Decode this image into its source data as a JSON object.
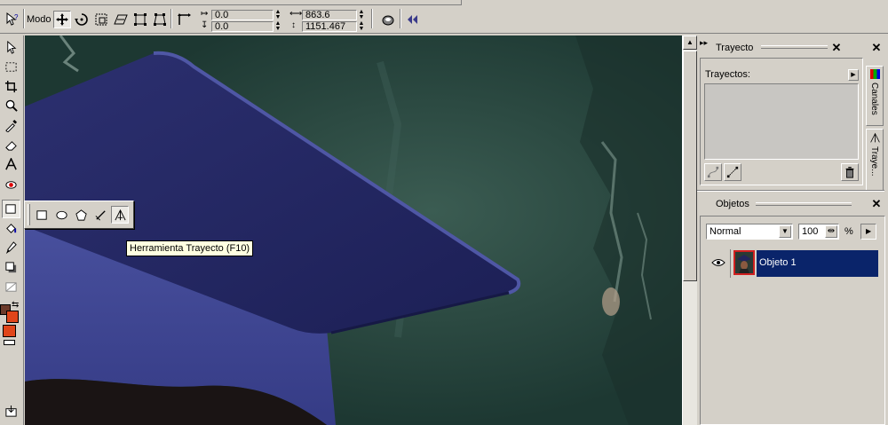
{
  "property_bar": {
    "mode_label": "Modo",
    "pos_x": "0.0",
    "pos_y": "0.0",
    "width": "863.6",
    "height": "1151.467"
  },
  "tools": [
    {
      "icon": "pick-tool-icon"
    },
    {
      "icon": "mask-tool-icon"
    },
    {
      "icon": "crop-tool-icon"
    },
    {
      "icon": "zoom-tool-icon"
    },
    {
      "icon": "eyedropper-tool-icon"
    },
    {
      "icon": "eraser-tool-icon"
    },
    {
      "icon": "text-tool-icon"
    },
    {
      "icon": "red-eye-tool-icon"
    },
    {
      "icon": "shape-tool-icon"
    },
    {
      "icon": "fill-tool-icon"
    },
    {
      "icon": "brush-tool-icon"
    },
    {
      "icon": "shadow-tool-icon"
    },
    {
      "icon": "transparency-tool-icon"
    }
  ],
  "colors": {
    "foreground": "#6b3a2a",
    "background": "#e0451a",
    "fill": "#e0451a",
    "selection": "#0a246a",
    "canvas_bg": "#25443c",
    "cap": "#3a3f7e"
  },
  "flyout": {
    "tools": [
      "rectangle-tool-icon",
      "ellipse-tool-icon",
      "polygon-tool-icon",
      "line-tool-icon",
      "path-tool-icon"
    ]
  },
  "tooltip": "Herramienta Trayecto (F10)",
  "trayecto_panel": {
    "title": "Trayecto",
    "list_label": "Trayectos:"
  },
  "side_tabs": {
    "canales": "Canales",
    "trayectos": "Traye..."
  },
  "objetos_panel": {
    "title": "Objetos",
    "blend_mode": "Normal",
    "opacity": "100",
    "opacity_unit": "%",
    "objects": [
      {
        "name": "Objeto 1",
        "selected": true
      }
    ]
  }
}
